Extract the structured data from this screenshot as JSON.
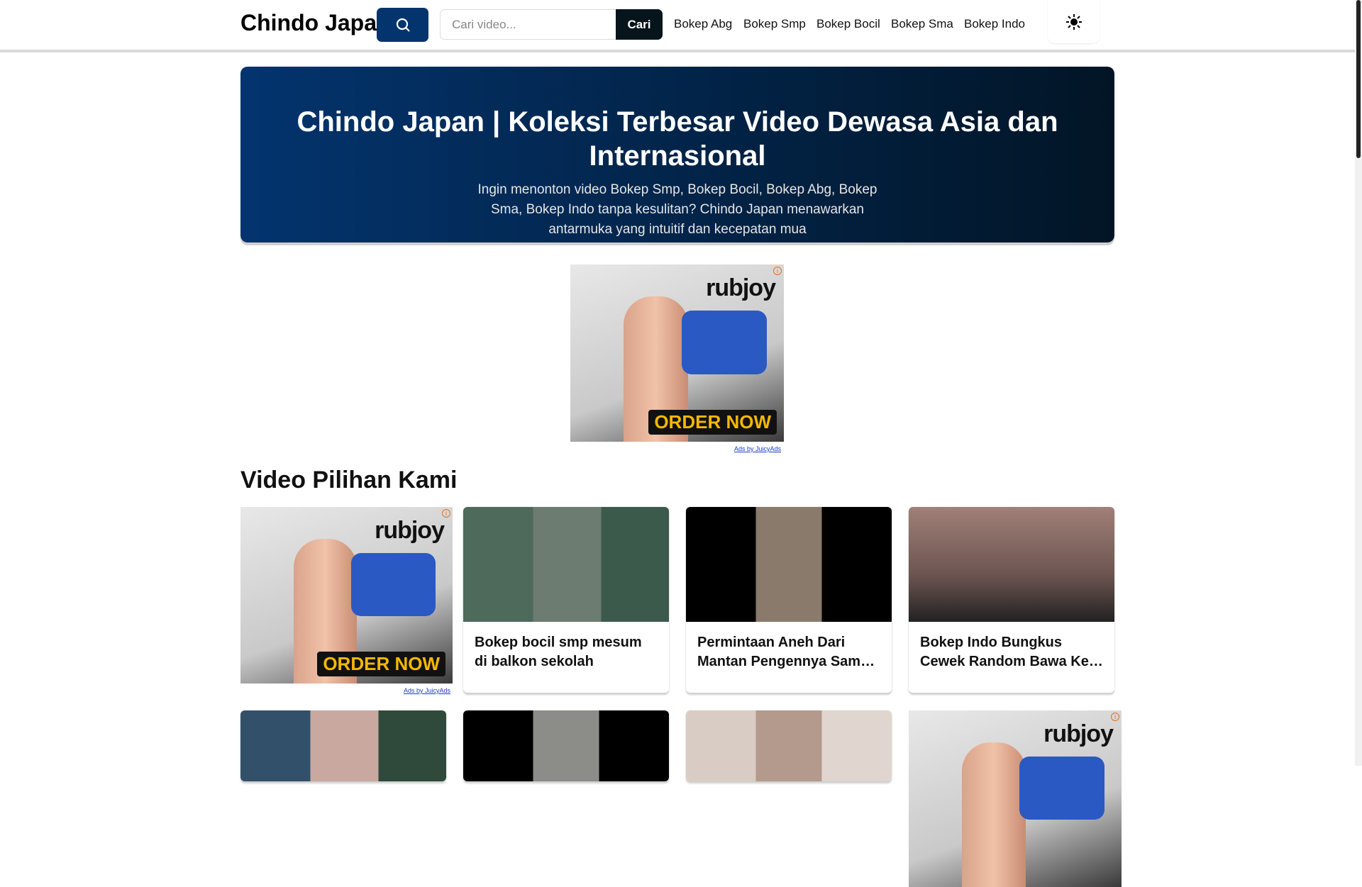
{
  "header": {
    "logo": "Chindo Japan",
    "search_placeholder": "Cari video...",
    "search_button": "Cari",
    "nav": [
      "Bokep Abg",
      "Bokep Smp",
      "Bokep Bocil",
      "Bokep Sma",
      "Bokep Indo"
    ]
  },
  "hero": {
    "title": "Chindo Japan | Koleksi Terbesar Video Dewasa Asia dan Internasional",
    "subtitle": "Ingin menonton video Bokep Smp, Bokep Bocil, Bokep Abg, Bokep Sma, Bokep Indo tanpa kesulitan? Chindo Japan menawarkan antarmuka yang intuitif dan kecepatan mua"
  },
  "ad": {
    "brand": "rubjoy",
    "cta": "ORDER NOW",
    "label": "Ads by JuicyAds",
    "info": "i"
  },
  "section_title": "Video Pilihan Kami",
  "videos": [
    {
      "title": "Bokep bocil smp mesum di balkon sekolah"
    },
    {
      "title": "Permintaan Aneh Dari Mantan Pengennya Sambil Dipijat"
    },
    {
      "title": "Bokep Indo Bungkus Cewek Random Bawa Ke Kos"
    }
  ],
  "colors": {
    "primary": "#03346e",
    "dark": "#06141b"
  }
}
